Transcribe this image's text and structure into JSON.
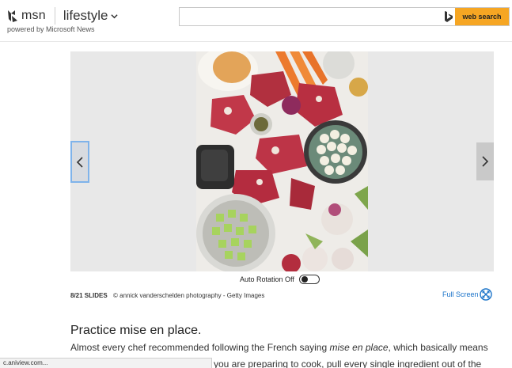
{
  "header": {
    "logo_text": "msn",
    "section": "lifestyle",
    "powered_by": "powered by Microsoft News",
    "search_placeholder": "",
    "search_button": "web search"
  },
  "slideshow": {
    "auto_rotation_label": "Auto Rotation Off",
    "slide_counter": "8/21 SLIDES",
    "credit": "© annick vanderschelden photography - Getty Images",
    "full_screen_label": "Full Screen"
  },
  "article": {
    "heading": "Practice mise en place.",
    "paragraph_line1_start": "Almost every chef recommended following the French saying ",
    "paragraph_line1_italic": "mise en place",
    "paragraph_line1_end": ", which basically means",
    "paragraph_line2": "you are preparing to cook, pull every single ingredient out of the"
  },
  "status_bar": {
    "text": "c.aniview.com..."
  },
  "colors": {
    "accent": "#f6a623",
    "link": "#1a73c9",
    "prev_border": "#7fb3ea"
  }
}
